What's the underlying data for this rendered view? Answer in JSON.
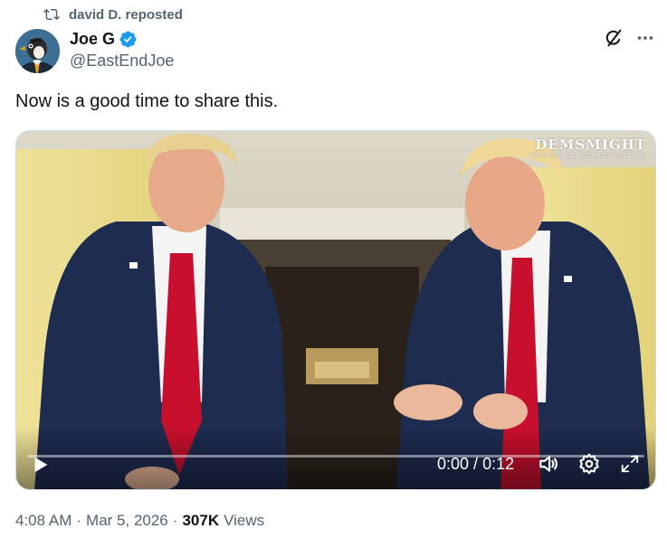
{
  "repost": {
    "label": "david D. reposted",
    "icon": "repost-icon"
  },
  "author": {
    "name": "Joe G",
    "handle": "@EastEndJoe",
    "verified": true,
    "verified_color": "#1d9bf0"
  },
  "tweet": {
    "text": "Now is a good time to share this."
  },
  "media": {
    "watermark": "DEMSMIGHT",
    "watermark_sub": "BECAUSE DEMOCRACY MATTERS",
    "current_time": "0:00",
    "separator": "/",
    "duration": "0:12",
    "progress": 0
  },
  "meta": {
    "time": "4:08 AM",
    "dot1": "·",
    "date": "Mar 5, 2026",
    "dot2": "·",
    "views_count": "307K",
    "views_label": "Views"
  },
  "colors": {
    "accent": "#1d9bf0",
    "secondary_text": "#536471",
    "primary_text": "#0f1419"
  }
}
